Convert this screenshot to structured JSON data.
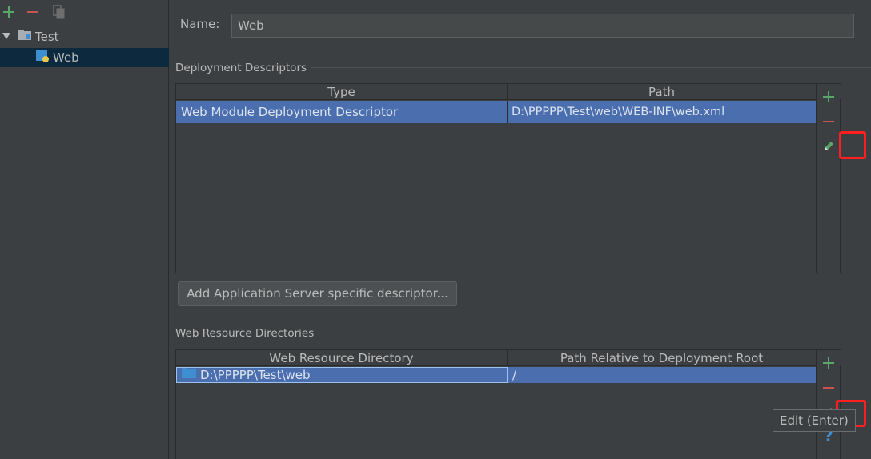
{
  "toolbar": {
    "add_icon": "plus-icon",
    "remove_icon": "minus-icon",
    "copy_icon": "copy-icon"
  },
  "tree": {
    "root": {
      "label": "Test",
      "icon": "folder-icon",
      "expanded": true
    },
    "child": {
      "label": "Web",
      "icon": "web-facet-icon",
      "selected": true
    }
  },
  "name_field": {
    "label": "Name:",
    "value": "Web"
  },
  "deployment": {
    "title": "Deployment Descriptors",
    "columns": [
      "Type",
      "Path"
    ],
    "rows": [
      {
        "type": "Web Module Deployment Descriptor",
        "path": "D:\\PPPPP\\Test\\web\\WEB-INF\\web.xml"
      }
    ],
    "add_descriptor_button": "Add Application Server specific descriptor..."
  },
  "resources": {
    "title": "Web Resource Directories",
    "columns": [
      "Web Resource Directory",
      "Path Relative to Deployment Root"
    ],
    "rows": [
      {
        "directory": "D:\\PPPPP\\Test\\web",
        "relative_path": "/"
      }
    ]
  },
  "tooltip": "Edit (Enter)",
  "colors": {
    "accent_add": "#59a869",
    "accent_remove": "#c75450",
    "selection": "#4b6eaf",
    "highlight_box": "#ff1f1f"
  }
}
